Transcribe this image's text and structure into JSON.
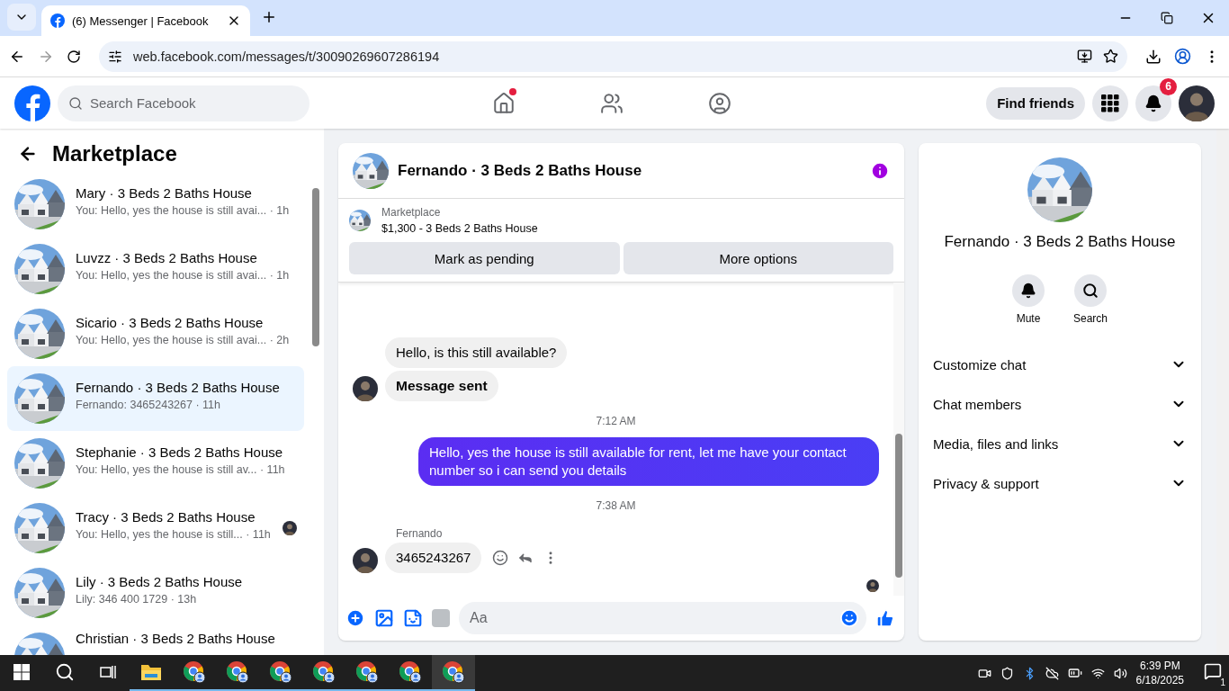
{
  "browser": {
    "tabs": [
      {
        "title": "(6) Messenger | Facebook",
        "selected": true
      }
    ],
    "url": "web.facebook.com/messages/t/30090269607286194"
  },
  "header": {
    "search_placeholder": "Search Facebook",
    "nav": [
      {
        "kind": "home",
        "notify": true
      },
      {
        "kind": "friends",
        "notify": false
      },
      {
        "kind": "groups",
        "notify": false
      }
    ],
    "find_friends": "Find friends",
    "notification_count": "6"
  },
  "sidebar": {
    "title": "Marketplace",
    "conversations": [
      {
        "title": "Mary · 3 Beds 2 Baths House",
        "preview": "You: Hello, yes the house is still avai... · 1h",
        "selected": false,
        "seen_avatar": false
      },
      {
        "title": "Luvzz · 3 Beds 2 Baths House",
        "preview": "You: Hello, yes the house is still avai... · 1h",
        "selected": false,
        "seen_avatar": false
      },
      {
        "title": "Sicario · 3 Beds 2 Baths House",
        "preview": "You: Hello, yes the house is still avai... · 2h",
        "selected": false,
        "seen_avatar": false
      },
      {
        "title": "Fernando · 3 Beds 2 Baths House",
        "preview": "Fernando: 3465243267 · 11h",
        "selected": true,
        "seen_avatar": false
      },
      {
        "title": "Stephanie · 3 Beds 2 Baths House",
        "preview": "You: Hello, yes the house is still av...  · 11h",
        "selected": false,
        "seen_avatar": false
      },
      {
        "title": "Tracy · 3 Beds 2 Baths House",
        "preview": "You: Hello, yes the house is still...  · 11h",
        "selected": false,
        "seen_avatar": true
      },
      {
        "title": "Lily · 3 Beds 2 Baths House",
        "preview": "Lily: 346 400 1729 · 13h",
        "selected": false,
        "seen_avatar": false
      },
      {
        "title": "Christian · 3 Beds 2 Baths House",
        "selected": false,
        "seen_avatar": false
      }
    ]
  },
  "chat": {
    "title": "Fernando · 3 Beds 2 Baths House",
    "listing": {
      "source": "Marketplace",
      "item": "$1,300 - 3 Beds 2 Baths House"
    },
    "actions": [
      "Mark as pending",
      "More options"
    ],
    "messages": [
      {
        "kind": "incoming",
        "text": "Hello, is this still available?",
        "avatar": false,
        "bold": false,
        "hovered": false
      },
      {
        "kind": "incoming",
        "text": "Message sent",
        "avatar": true,
        "bold": true,
        "hovered": false
      },
      {
        "kind": "time",
        "text": "7:12 AM"
      },
      {
        "kind": "outgoing",
        "text": "Hello, yes the house is still available for rent, let me have your contact number so i can send you  details"
      },
      {
        "kind": "time",
        "text": "7:38 AM"
      },
      {
        "kind": "sender",
        "text": "Fernando"
      },
      {
        "kind": "incoming",
        "text": "3465243267",
        "avatar": true,
        "bold": false,
        "hovered": true
      }
    ],
    "seen": true,
    "composer_placeholder": "Aa"
  },
  "details": {
    "title": "Fernando · 3 Beds 2 Baths House",
    "actions": [
      {
        "kind": "mute",
        "label": "Mute"
      },
      {
        "kind": "search",
        "label": "Search"
      }
    ],
    "sections": [
      {
        "label": "Customize chat",
        "expanded": false
      },
      {
        "label": "Chat members",
        "expanded": false
      },
      {
        "label": "Media, files and links",
        "expanded": false
      },
      {
        "label": "Privacy & support",
        "expanded": false
      }
    ]
  },
  "taskbar": {
    "apps": [
      {
        "kind": "files",
        "active": false
      },
      {
        "kind": "chrome",
        "active": false
      },
      {
        "kind": "chrome",
        "active": false
      },
      {
        "kind": "chrome",
        "active": false
      },
      {
        "kind": "chrome",
        "active": false
      },
      {
        "kind": "chrome",
        "active": false
      },
      {
        "kind": "chrome",
        "active": false
      },
      {
        "kind": "chrome",
        "active": true
      }
    ],
    "time": "6:39 PM",
    "date": "6/18/2025",
    "notifications": "1"
  }
}
